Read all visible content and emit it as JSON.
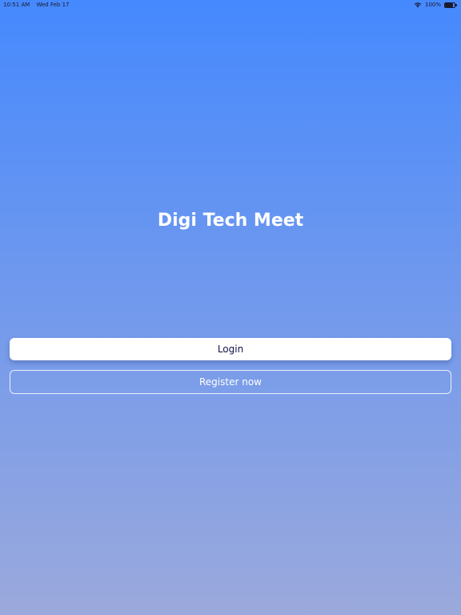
{
  "status_bar": {
    "time": "10:51 AM",
    "date": "Wed Feb 17",
    "battery_text": "100%",
    "battery_level": 1.0,
    "wifi_icon": "wifi-icon",
    "battery_icon": "battery-icon"
  },
  "app": {
    "title": "Digi Tech Meet"
  },
  "buttons": {
    "login_label": "Login",
    "register_label": "Register now"
  },
  "colors": {
    "gradient_top": "#4589fe",
    "gradient_bottom": "#9ba9dc",
    "login_text": "#12124a"
  }
}
